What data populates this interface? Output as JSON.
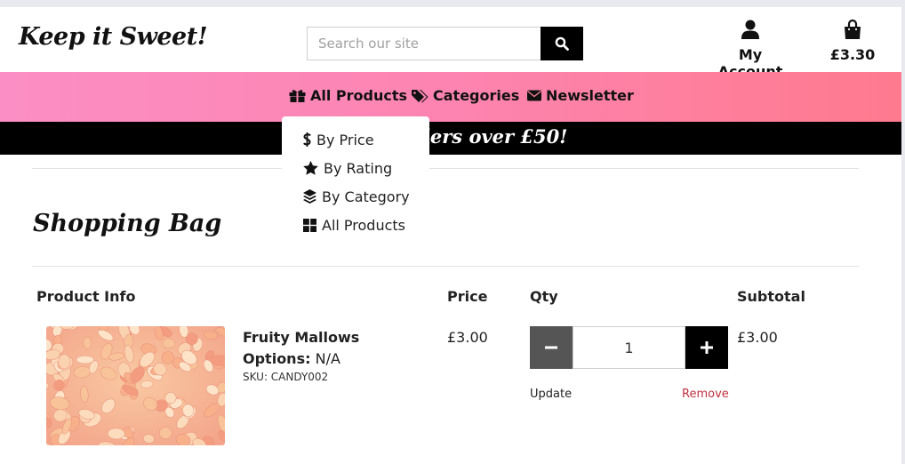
{
  "header": {
    "brand": "Keep it Sweet!",
    "search_placeholder": "Search our site",
    "account_label": "My Account",
    "bag_total": "£3.30"
  },
  "nav": {
    "items": [
      {
        "label": "All Products",
        "icon": "gift-icon"
      },
      {
        "label": "Categories",
        "icon": "tags-icon"
      },
      {
        "label": "Newsletter",
        "icon": "envelope-icon"
      }
    ],
    "dropdown": [
      {
        "label": "By Price",
        "icon": "dollar-icon"
      },
      {
        "label": "By Rating",
        "icon": "star-icon"
      },
      {
        "label": "By Category",
        "icon": "layer-group-icon"
      },
      {
        "label": "All Products",
        "icon": "grid-icon"
      }
    ]
  },
  "banner": {
    "text": "n orders over £50!"
  },
  "bag_page": {
    "title": "Shopping Bag",
    "columns": [
      "Product Info",
      "Price",
      "Qty",
      "Subtotal"
    ],
    "items": [
      {
        "name": "Fruity Mallows",
        "options_label": "Options:",
        "options_value": "N/A",
        "sku": "SKU: CANDY002",
        "price": "£3.00",
        "qty": "1",
        "subtotal": "£3.00",
        "update_label": "Update",
        "remove_label": "Remove"
      }
    ]
  },
  "colors": {
    "nav_gradient_start": "#fb8ec4",
    "nav_gradient_end": "#fe7a8e",
    "remove": "#c0303f",
    "banner_bg": "#000000"
  }
}
